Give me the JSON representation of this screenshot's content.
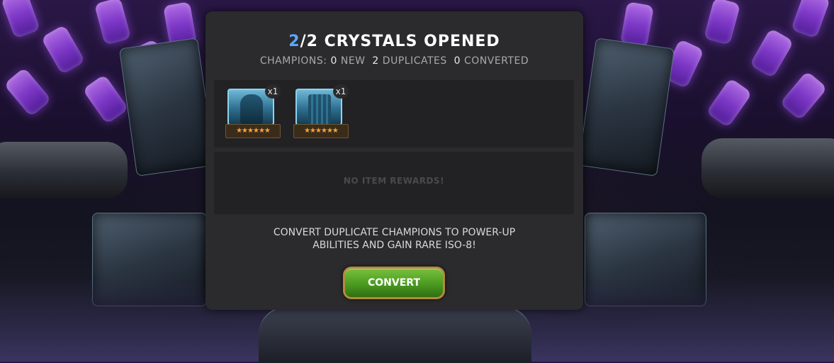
{
  "header": {
    "title_count": "2",
    "title_rest": "/2 CRYSTALS OPENED"
  },
  "summary": {
    "label": "CHAMPIONS:",
    "new_count": "0",
    "new_label": "NEW",
    "dup_count": "2",
    "dup_label": "DUPLICATES",
    "conv_count": "0",
    "conv_label": "CONVERTED"
  },
  "champions": [
    {
      "count": "x1",
      "stars": "★★★★★★",
      "icon": "champion-portrait-icon"
    },
    {
      "count": "x1",
      "stars": "★★★★★★",
      "icon": "champion-portrait-icon"
    }
  ],
  "items": {
    "empty_text": "NO ITEM REWARDS!"
  },
  "info": {
    "line1": "CONVERT DUPLICATE CHAMPIONS TO POWER-UP",
    "line2": "ABILITIES AND GAIN RARE ISO-8!"
  },
  "actions": {
    "convert_label": "CONVERT"
  },
  "colors": {
    "accent": "#5aa8ff",
    "button": "#4a9a20",
    "star": "#f3a33b"
  }
}
